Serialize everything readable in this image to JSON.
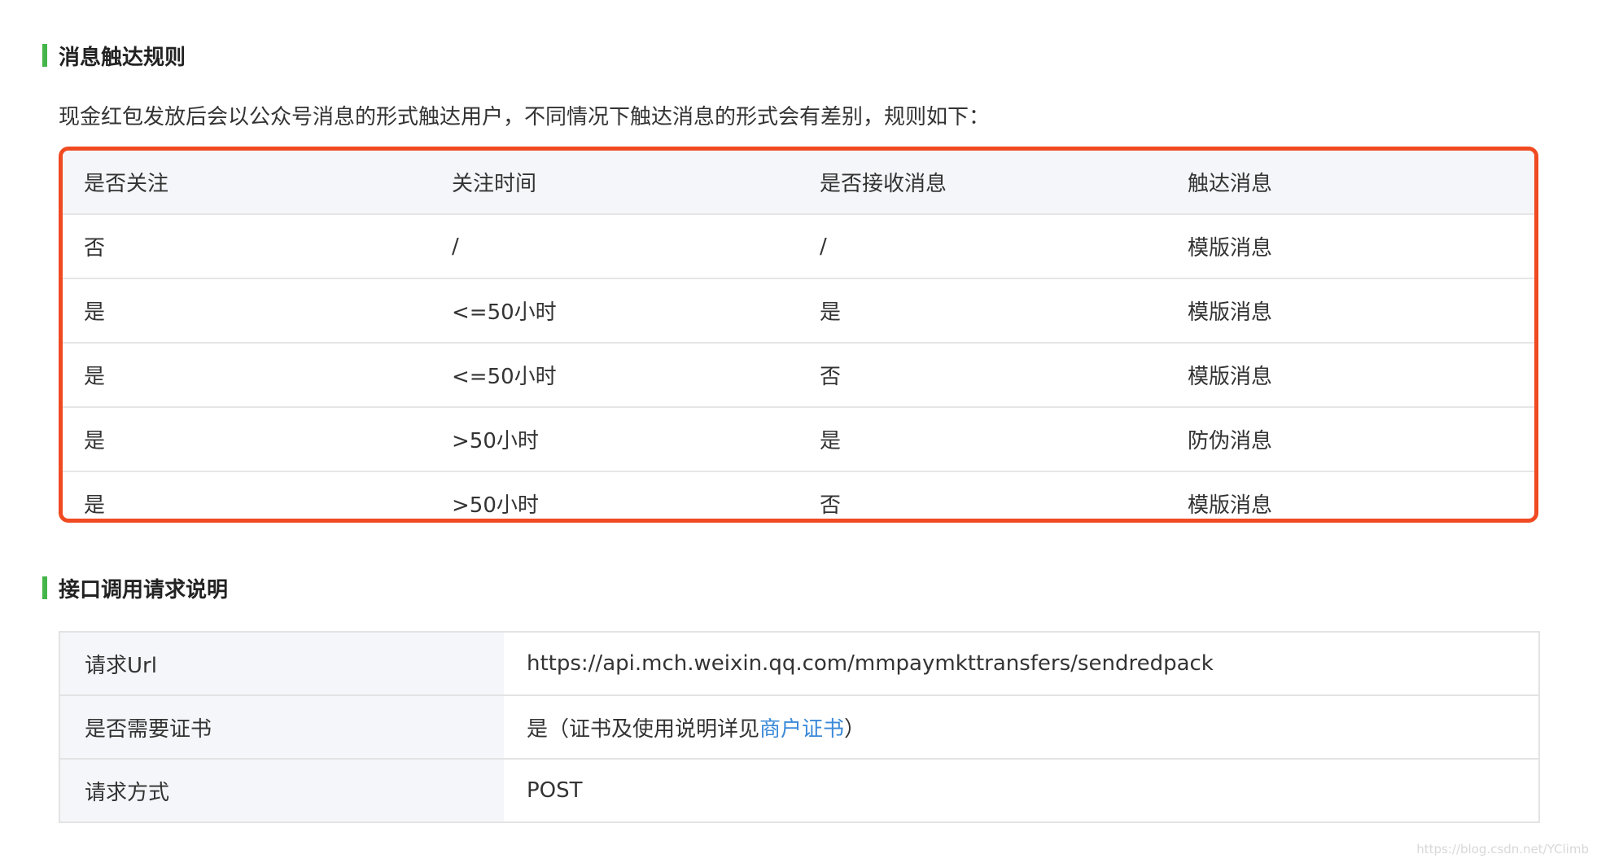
{
  "section1": {
    "title": "消息触达规则"
  },
  "description": "现金红包发放后会以公众号消息的形式触达用户，不同情况下触达消息的形式会有差别，规则如下：",
  "rules_table": {
    "headers": [
      "是否关注",
      "关注时间",
      "是否接收消息",
      "触达消息"
    ],
    "rows": [
      [
        "否",
        "/",
        "/",
        "模版消息"
      ],
      [
        "是",
        "<=50小时",
        "是",
        "模版消息"
      ],
      [
        "是",
        "<=50小时",
        "否",
        "模版消息"
      ],
      [
        "是",
        ">50小时",
        "是",
        "防伪消息"
      ],
      [
        "是",
        ">50小时",
        "否",
        "模版消息"
      ]
    ]
  },
  "section2": {
    "title": "接口调用请求说明"
  },
  "api_table": {
    "rows": [
      {
        "key": "请求Url",
        "value": "https://api.mch.weixin.qq.com/mmpaymkttransfers/sendredpack"
      },
      {
        "key": "是否需要证书",
        "value_prefix": "是（证书及使用说明详见",
        "link_text": "商户证书",
        "value_suffix": "）"
      },
      {
        "key": "请求方式",
        "value": "POST"
      }
    ]
  },
  "watermark": "https://blog.csdn.net/YClimb",
  "colors": {
    "accent_bar": "#44b549",
    "highlight_border": "#f04a22",
    "link": "#3b8ad9"
  }
}
